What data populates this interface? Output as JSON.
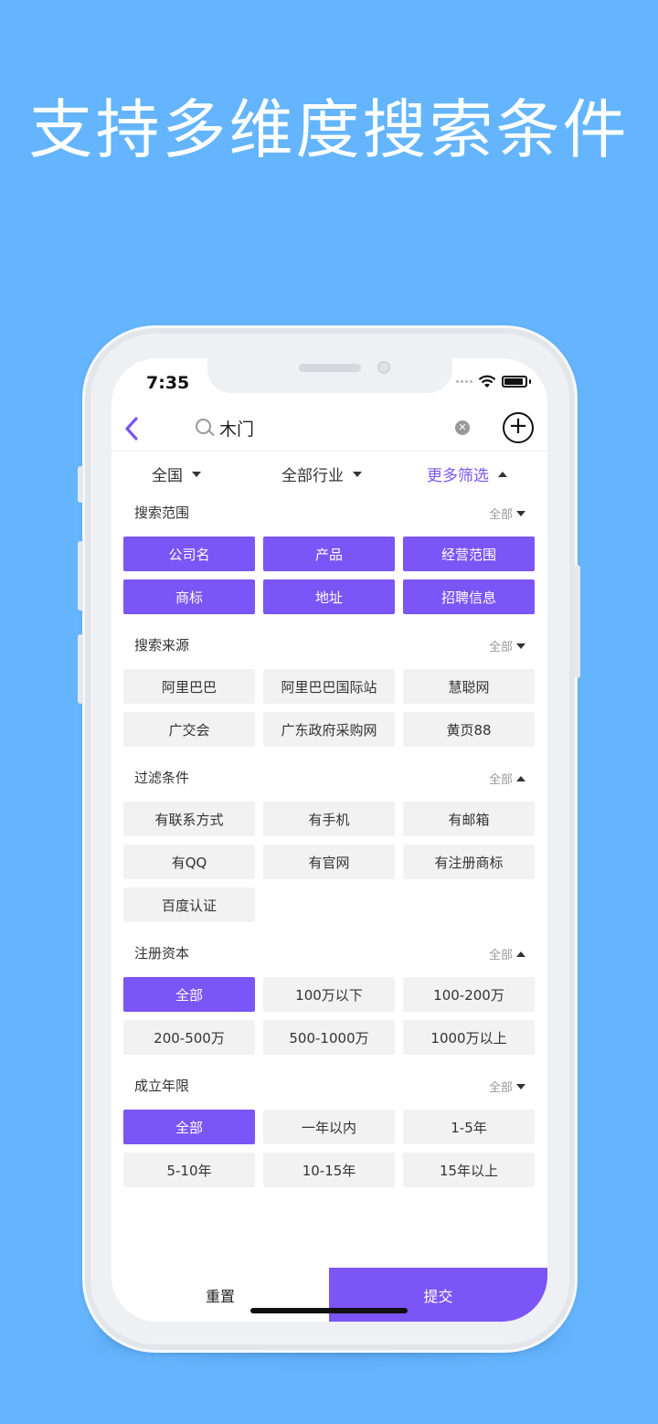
{
  "headline": "支持多维度搜索条件",
  "status": {
    "time": "7:35"
  },
  "search": {
    "query": "木门"
  },
  "filters": {
    "region": "全国",
    "industry": "全部行业",
    "more": "更多筛选"
  },
  "sections": [
    {
      "title": "搜索范围",
      "all": "全部",
      "arrow": "down",
      "options": [
        {
          "label": "公司名",
          "selected": true
        },
        {
          "label": "产品",
          "selected": true
        },
        {
          "label": "经营范围",
          "selected": true
        },
        {
          "label": "商标",
          "selected": true
        },
        {
          "label": "地址",
          "selected": true
        },
        {
          "label": "招聘信息",
          "selected": true
        }
      ]
    },
    {
      "title": "搜索来源",
      "all": "全部",
      "arrow": "down",
      "options": [
        {
          "label": "阿里巴巴",
          "selected": false
        },
        {
          "label": "阿里巴巴国际站",
          "selected": false
        },
        {
          "label": "慧聪网",
          "selected": false
        },
        {
          "label": "广交会",
          "selected": false
        },
        {
          "label": "广东政府采购网",
          "selected": false
        },
        {
          "label": "黄页88",
          "selected": false
        }
      ]
    },
    {
      "title": "过滤条件",
      "all": "全部",
      "arrow": "up",
      "options": [
        {
          "label": "有联系方式",
          "selected": false
        },
        {
          "label": "有手机",
          "selected": false
        },
        {
          "label": "有邮箱",
          "selected": false
        },
        {
          "label": "有QQ",
          "selected": false
        },
        {
          "label": "有官网",
          "selected": false
        },
        {
          "label": "有注册商标",
          "selected": false
        },
        {
          "label": "百度认证",
          "selected": false
        }
      ]
    },
    {
      "title": "注册资本",
      "all": "全部",
      "arrow": "up",
      "options": [
        {
          "label": "全部",
          "selected": true
        },
        {
          "label": "100万以下",
          "selected": false
        },
        {
          "label": "100-200万",
          "selected": false
        },
        {
          "label": "200-500万",
          "selected": false
        },
        {
          "label": "500-1000万",
          "selected": false
        },
        {
          "label": "1000万以上",
          "selected": false
        }
      ]
    },
    {
      "title": "成立年限",
      "all": "全部",
      "arrow": "down",
      "options": [
        {
          "label": "全部",
          "selected": true
        },
        {
          "label": "一年以内",
          "selected": false
        },
        {
          "label": "1-5年",
          "selected": false
        },
        {
          "label": "5-10年",
          "selected": false
        },
        {
          "label": "10-15年",
          "selected": false
        },
        {
          "label": "15年以上",
          "selected": false
        }
      ]
    }
  ],
  "actions": {
    "reset": "重置",
    "submit": "提交"
  },
  "colors": {
    "accent": "#7b55f5",
    "background": "#64b5fd"
  }
}
